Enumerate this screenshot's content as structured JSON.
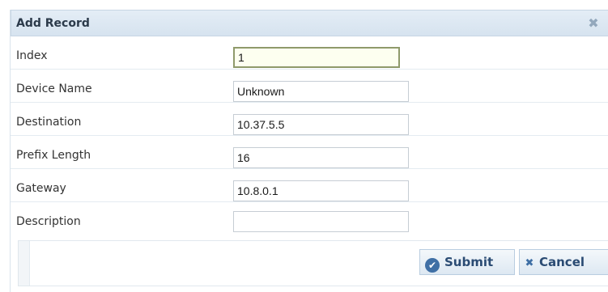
{
  "dialog": {
    "title": "Add Record",
    "close_icon": "close-icon"
  },
  "fields": [
    {
      "label": "Index",
      "value": "1"
    },
    {
      "label": "Device Name",
      "value": "Unknown"
    },
    {
      "label": "Destination",
      "value": "10.37.5.5"
    },
    {
      "label": "Prefix Length",
      "value": "16"
    },
    {
      "label": "Gateway",
      "value": "10.8.0.1"
    },
    {
      "label": "Description",
      "value": ""
    }
  ],
  "buttons": {
    "submit_label": "Submit",
    "submit_icon": "check-circle-icon",
    "cancel_label": "Cancel",
    "cancel_icon": "x-icon"
  },
  "colors": {
    "titlebar": "#d6e3ef",
    "button_text": "#2a4b73",
    "icon_blue": "#3f6fa5"
  }
}
